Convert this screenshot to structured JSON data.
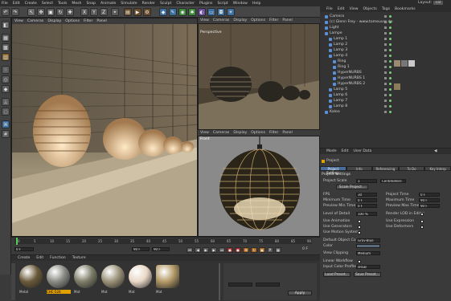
{
  "app": {
    "menu": [
      "File",
      "Edit",
      "Create",
      "Select",
      "Tools",
      "Mesh",
      "Snap",
      "Animate",
      "Simulate",
      "Render",
      "Sculpt",
      "Character",
      "Plugins",
      "Script",
      "Window",
      "Help"
    ],
    "layout_label": "Layout:",
    "layout_value": "cal"
  },
  "viewport_main": {
    "menu": [
      "View",
      "Cameras",
      "Display",
      "Options",
      "Filter",
      "Panel"
    ]
  },
  "viewport_perspective": {
    "label": "Perspective",
    "menu": [
      "View",
      "Cameras",
      "Display",
      "Options",
      "Filter",
      "Panel"
    ]
  },
  "viewport_front": {
    "label": "Front",
    "menu": [
      "View",
      "Cameras",
      "Display",
      "Options",
      "Filter",
      "Panel"
    ]
  },
  "object_manager": {
    "tabs": [
      "File",
      "Edit",
      "View",
      "Objects",
      "Tags",
      "Bookmarks"
    ],
    "items": [
      {
        "name": "Camera",
        "indent": 0
      },
      {
        "name": "(c) Glenn Frey - www.tomeuvre.de",
        "indent": 0
      },
      {
        "name": "Light",
        "indent": 0
      },
      {
        "name": "Lampe",
        "indent": 0
      },
      {
        "name": "Lamp 1",
        "indent": 1
      },
      {
        "name": "Lamp 2",
        "indent": 1
      },
      {
        "name": "Lamp 3",
        "indent": 1
      },
      {
        "name": "Lamp 4",
        "indent": 1
      },
      {
        "name": "Ring",
        "indent": 2
      },
      {
        "name": "Ring 1",
        "indent": 2
      },
      {
        "name": "HyperNURBS",
        "indent": 2
      },
      {
        "name": "HyperNURBS 1",
        "indent": 2
      },
      {
        "name": "HyperNURBS 2",
        "indent": 2
      },
      {
        "name": "Lamp 5",
        "indent": 1
      },
      {
        "name": "Lamp 6",
        "indent": 1
      },
      {
        "name": "Lamp 7",
        "indent": 1
      },
      {
        "name": "Lamp 8",
        "indent": 1
      },
      {
        "name": "Kaleo",
        "indent": 0
      }
    ]
  },
  "attribute_manager": {
    "tabs": [
      "Mode",
      "Edit",
      "User Data"
    ],
    "header": "Project",
    "subtabs": [
      "Project Settings",
      "Info",
      "Referencing",
      "To Do",
      "Key Interp"
    ],
    "section": "Project Settings",
    "project_scale_label": "Project Scale",
    "project_scale_value": "1",
    "project_scale_unit": "Centimeters",
    "scale_project_button": "Scale Project...",
    "fps_label": "FPS",
    "fps_value": "30",
    "project_time_label": "Project Time",
    "project_time_value": "0 F",
    "min_time_label": "Minimum Time",
    "min_time_value": "0 F",
    "max_time_label": "Maximum Time",
    "max_time_value": "90 F",
    "preview_min_label": "Preview Min Time",
    "preview_min_value": "0 F",
    "preview_max_label": "Preview Max Time",
    "preview_max_value": "90 F",
    "lod_label": "Level of Detail",
    "lod_value": "100 %",
    "render_lod_label": "Render LOD in Editor",
    "use_animation_label": "Use Animation",
    "use_expression_label": "Use Expression",
    "use_generators_label": "Use Generators",
    "use_deformers_label": "Use Deformers",
    "use_motion_label": "Use Motion System",
    "default_color_label": "Default Object Color",
    "default_color_value": "Gray-Blue",
    "color_label": "Color",
    "view_clipping_label": "View Clipping",
    "view_clipping_value": "Medium",
    "linear_workflow_label": "Linear Workflow",
    "input_color_label": "Input Color Profile",
    "input_color_value": "sRGB",
    "load_preset_button": "Load Preset...",
    "save_preset_button": "Save Preset..."
  },
  "timeline": {
    "ticks": [
      "0",
      "5",
      "10",
      "15",
      "20",
      "25",
      "30",
      "35",
      "40",
      "45",
      "50",
      "55",
      "60",
      "65",
      "70",
      "75",
      "80",
      "85",
      "90"
    ],
    "current_frame": "0 F",
    "start_field": "0 F",
    "end_field": "90 F",
    "end_field2": "90 F",
    "frame_readout": "0 F"
  },
  "material_manager": {
    "tabs": [
      "Create",
      "Edit",
      "Function",
      "Texture"
    ],
    "materials": [
      {
        "name": "Metal",
        "color": "#6a5a3a"
      },
      {
        "name": "CHC-524",
        "color": "#8a8a84"
      },
      {
        "name": "Mat",
        "color": "#7e7d68"
      },
      {
        "name": "Mat",
        "color": "#9a9178"
      },
      {
        "name": "Mat",
        "color": "#e9d7c6"
      },
      {
        "name": "Mat",
        "color": "#b49a68"
      }
    ],
    "apply_button": "Apply"
  },
  "colors": {
    "accent": "#e0a000",
    "bg": "#3a3a3a",
    "panel": "#333333",
    "menubar": "#2c2c2c",
    "selection": "#4a6d9c"
  }
}
